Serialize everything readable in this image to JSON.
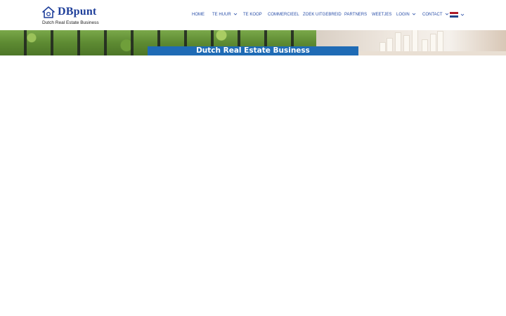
{
  "brand": {
    "name": "DBpunt",
    "tagline": "Dutch Real Estate Business"
  },
  "nav": {
    "items": [
      {
        "label": "HOME",
        "has_dropdown": false
      },
      {
        "label": "TE HUUR",
        "has_dropdown": true
      },
      {
        "label": "TE KOOP",
        "has_dropdown": false
      },
      {
        "label": "COMMERCIEEL",
        "has_dropdown": false
      },
      {
        "label": "ZOEK UITGEBREID",
        "has_dropdown": false
      },
      {
        "label": "PARTNERS",
        "has_dropdown": false
      },
      {
        "label": "WEETJES",
        "has_dropdown": false
      },
      {
        "label": "LOGIN",
        "has_dropdown": true
      },
      {
        "label": "CONTACT",
        "has_dropdown": true
      }
    ],
    "language_flag": "netherlands-flag-icon",
    "link_color": "#2a4fa8"
  },
  "banner": {
    "title": "Dutch Real Estate Business",
    "title_bg": "#1f6bb5"
  },
  "colors": {
    "brand": "#1f3f9a",
    "accent": "#1f6bb5"
  }
}
